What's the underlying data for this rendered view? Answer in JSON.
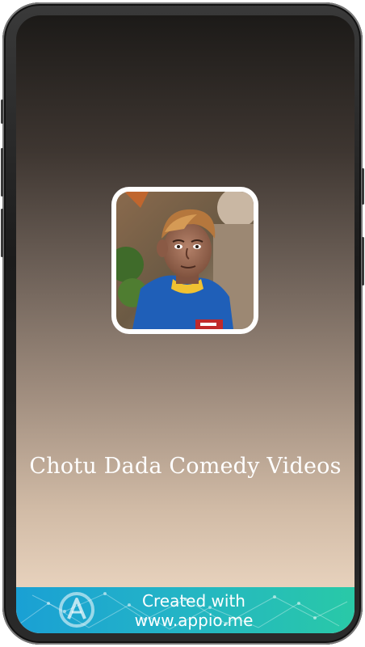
{
  "app": {
    "title": "Chotu Dada Comedy Videos",
    "logo_icon": "chotu-dada-photo-icon"
  },
  "banner": {
    "line1": "Created with",
    "line2": "www.appio.me",
    "logo_icon": "appio-logo-icon",
    "colors": {
      "start": "#1aa0d4",
      "end": "#29c9a7"
    }
  },
  "colors": {
    "background_top": "#1c1a18",
    "background_bottom": "#f4dfca",
    "title_text": "#ffffff"
  }
}
